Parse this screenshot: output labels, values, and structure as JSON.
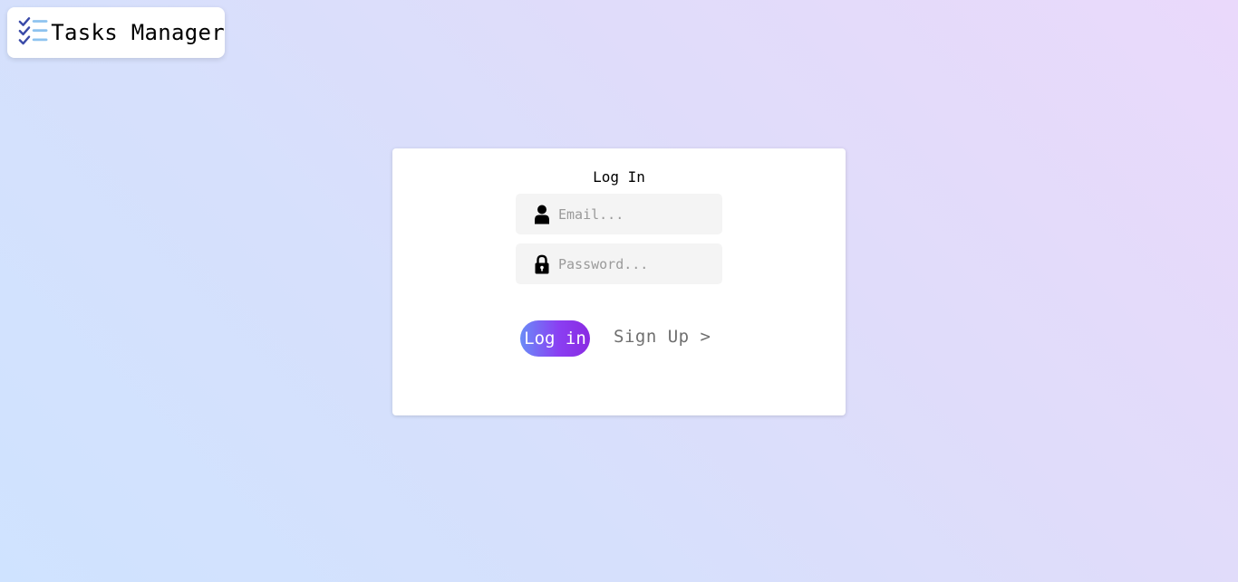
{
  "app": {
    "title": "Tasks Manager",
    "logo_icon": "checklist-icon"
  },
  "login": {
    "title": "Log In",
    "email": {
      "icon": "user-icon",
      "placeholder": "Email...",
      "value": ""
    },
    "password": {
      "icon": "lock-icon",
      "placeholder": "Password...",
      "value": ""
    },
    "login_button": "Log in",
    "signup_link": "Sign Up >"
  },
  "colors": {
    "background_start": "#cfe3ff",
    "background_end": "#ead9fb",
    "button_gradient_start": "#6a8cf7",
    "button_gradient_end": "#8a2be2",
    "link": "#6f6f6f",
    "input_bg": "#f4f4f4"
  }
}
